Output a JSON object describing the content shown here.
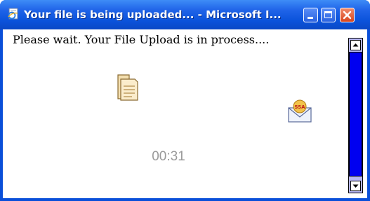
{
  "window": {
    "title": "Your file is being uploaded... - Microsoft I..."
  },
  "content": {
    "message": "Please wait. Your File Upload is in process....",
    "timer": "00:31",
    "mail_icon_label": "SSA"
  },
  "icons": {
    "app": "ie-page-icon",
    "document": "document-stack-icon",
    "mail": "ssa-mail-icon",
    "minimize": "minimize-icon",
    "maximize": "maximize-icon",
    "close": "close-icon"
  },
  "colors": {
    "titlebar": "#0b53db",
    "close_button": "#d8451d",
    "timer_text": "#9a9a9a",
    "scrollbar_track": "#b6b6f6",
    "scrollbar_thumb": "#0000f0"
  }
}
